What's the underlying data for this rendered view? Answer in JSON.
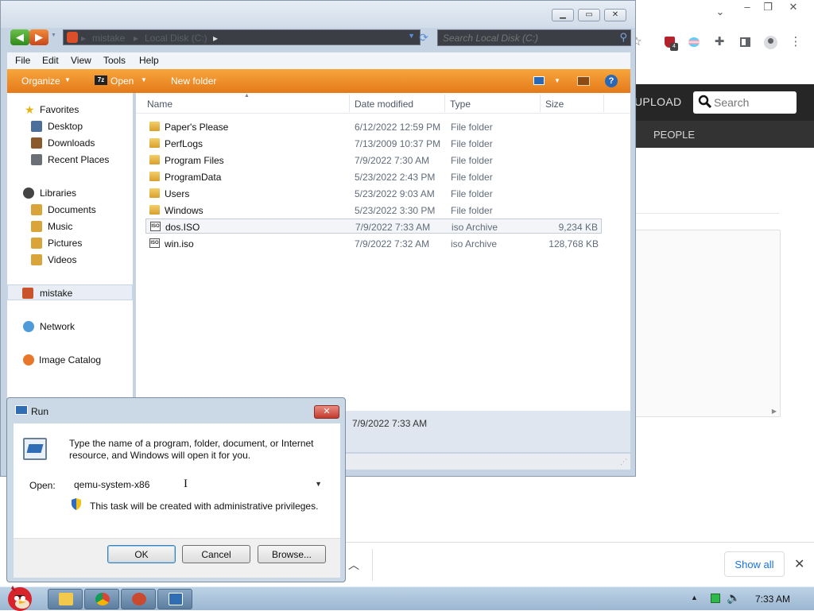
{
  "browser": {
    "site": {
      "upload_label": "UPLOAD",
      "search_placeholder": "Search",
      "people_label": "PEOPLE"
    },
    "extensions": [
      "shield-extension-icon",
      "trans-flag-extension-icon",
      "puzzle-icon",
      "sidebar-icon",
      "profile-icon",
      "kebab-menu-icon"
    ],
    "download_bar": {
      "show_all_label": "Show all"
    }
  },
  "explorer": {
    "address": {
      "crumbs": [
        "mistake",
        "Local Disk (C:)"
      ]
    },
    "search_placeholder": "Search Local Disk (C:)",
    "menu": [
      "File",
      "Edit",
      "View",
      "Tools",
      "Help"
    ],
    "toolbar": {
      "organize": "Organize",
      "open": "Open",
      "zip_badge": "7z",
      "new_folder": "New folder"
    },
    "nav": {
      "favorites": "Favorites",
      "desktop": "Desktop",
      "downloads": "Downloads",
      "recent_places": "Recent Places",
      "libraries": "Libraries",
      "documents": "Documents",
      "music": "Music",
      "pictures": "Pictures",
      "videos": "Videos",
      "mistake": "mistake",
      "network": "Network",
      "image_catalog": "Image Catalog"
    },
    "columns": {
      "name": "Name",
      "date": "Date modified",
      "type": "Type",
      "size": "Size"
    },
    "files": [
      {
        "name": "Paper's Please",
        "date": "6/12/2022 12:59 PM",
        "type": "File folder",
        "size": "",
        "icon": "folder"
      },
      {
        "name": "PerfLogs",
        "date": "7/13/2009 10:37 PM",
        "type": "File folder",
        "size": "",
        "icon": "folder"
      },
      {
        "name": "Program Files",
        "date": "7/9/2022 7:30 AM",
        "type": "File folder",
        "size": "",
        "icon": "folder"
      },
      {
        "name": "ProgramData",
        "date": "5/23/2022 2:43 PM",
        "type": "File folder",
        "size": "",
        "icon": "folder"
      },
      {
        "name": "Users",
        "date": "5/23/2022 9:03 AM",
        "type": "File folder",
        "size": "",
        "icon": "folder"
      },
      {
        "name": "Windows",
        "date": "5/23/2022 3:30 PM",
        "type": "File folder",
        "size": "",
        "icon": "folder"
      },
      {
        "name": "dos.ISO",
        "date": "7/9/2022 7:33 AM",
        "type": "iso Archive",
        "size": "9,234 KB",
        "icon": "iso"
      },
      {
        "name": "win.iso",
        "date": "7/9/2022 7:32 AM",
        "type": "iso Archive",
        "size": "128,768 KB",
        "icon": "iso"
      }
    ],
    "details": {
      "date_modified": "7/9/2022 7:33 AM"
    }
  },
  "run_dialog": {
    "title": "Run",
    "description": "Type the name of a program, folder, document, or Internet resource, and Windows will open it for you.",
    "open_label": "Open:",
    "open_value": "qemu-system-x86",
    "admin_note": "This task will be created with administrative privileges.",
    "ok_label": "OK",
    "cancel_label": "Cancel",
    "browse_label": "Browse..."
  },
  "taskbar": {
    "apps": [
      "explorer-icon",
      "chrome-icon",
      "app-icon",
      "run-icon"
    ],
    "clock": "7:33 AM"
  }
}
